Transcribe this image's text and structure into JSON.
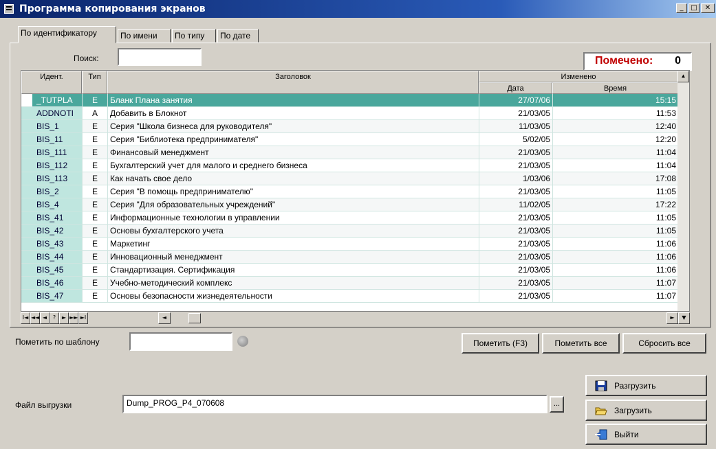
{
  "window": {
    "title": "Программа копирования экранов"
  },
  "tabs": [
    {
      "label": "По идентификатору",
      "active": true
    },
    {
      "label": "По имени",
      "active": false
    },
    {
      "label": "По типу",
      "active": false
    },
    {
      "label": "По дате",
      "active": false
    }
  ],
  "search": {
    "label": "Поиск:",
    "value": ""
  },
  "marked": {
    "label": "Помечено:",
    "count": "0"
  },
  "grid": {
    "headers": {
      "id": "Идент.",
      "type": "Тип",
      "title": "Заголовок",
      "changed": "Изменено",
      "date": "Дата",
      "time": "Время"
    },
    "rows": [
      {
        "id": "_TUTPLA",
        "type": "E",
        "title": "Бланк Плана занятия",
        "date": "27/07/06",
        "time": "15:15",
        "selected": true
      },
      {
        "id": "ADDNOTI",
        "type": "A",
        "title": "Добавить в Блокнот",
        "date": "21/03/05",
        "time": "11:53"
      },
      {
        "id": "BIS_1",
        "type": "E",
        "title": "Серия \"Школа бизнеса для руководителя\"",
        "date": "11/03/05",
        "time": "12:40"
      },
      {
        "id": "BIS_11",
        "type": "E",
        "title": "Серия \"Библиотека предпринимателя\"",
        "date": "5/02/05",
        "time": "12:20"
      },
      {
        "id": "BIS_111",
        "type": "E",
        "title": "Финансовый менеджмент",
        "date": "21/03/05",
        "time": "11:04"
      },
      {
        "id": "BIS_112",
        "type": "E",
        "title": "Бухгалтерский учет для малого и среднего бизнеса",
        "date": "21/03/05",
        "time": "11:04"
      },
      {
        "id": "BIS_113",
        "type": "E",
        "title": "Как начать свое дело",
        "date": "1/03/06",
        "time": "17:08"
      },
      {
        "id": "BIS_2",
        "type": "E",
        "title": "Серия \"В помощь предпринимателю\"",
        "date": "21/03/05",
        "time": "11:05"
      },
      {
        "id": "BIS_4",
        "type": "E",
        "title": "Серия \"Для образовательных учреждений\"",
        "date": "11/02/05",
        "time": "17:22"
      },
      {
        "id": "BIS_41",
        "type": "E",
        "title": "Информационные технологии в управлении",
        "date": "21/03/05",
        "time": "11:05"
      },
      {
        "id": "BIS_42",
        "type": "E",
        "title": "Основы бухгалтерского учета",
        "date": "21/03/05",
        "time": "11:05"
      },
      {
        "id": "BIS_43",
        "type": "E",
        "title": "Маркетинг",
        "date": "21/03/05",
        "time": "11:06"
      },
      {
        "id": "BIS_44",
        "type": "E",
        "title": "Инновационный менеджмент",
        "date": "21/03/05",
        "time": "11:06"
      },
      {
        "id": "BIS_45",
        "type": "E",
        "title": "Стандартизация. Сертификация",
        "date": "21/03/05",
        "time": "11:06"
      },
      {
        "id": "BIS_46",
        "type": "E",
        "title": "Учебно-методический комплекс",
        "date": "21/03/05",
        "time": "11:07"
      },
      {
        "id": "BIS_47",
        "type": "E",
        "title": "Основы безопасности жизнедеятельности",
        "date": "21/03/05",
        "time": "11:07"
      }
    ]
  },
  "nav_buttons": [
    "I◄",
    "◄◄",
    "◄",
    "?",
    "►",
    "►►",
    "►I"
  ],
  "pattern": {
    "label": "Пометить по шаблону",
    "value": ""
  },
  "buttons": {
    "mark": "Пометить (F3)",
    "mark_all": "Пометить все",
    "reset_all": "Сбросить все",
    "unload": "Разгрузить",
    "load": "Загрузить",
    "exit": "Выйти"
  },
  "dump": {
    "label": "Файл выгрузки",
    "value": "Dump_PROG_P4_070608",
    "browse": "..."
  },
  "colors": {
    "selected_row": "#4aa79c",
    "id_column": "#bfe6df",
    "marked_label": "#c00000",
    "titlebar": "#0a246a"
  }
}
